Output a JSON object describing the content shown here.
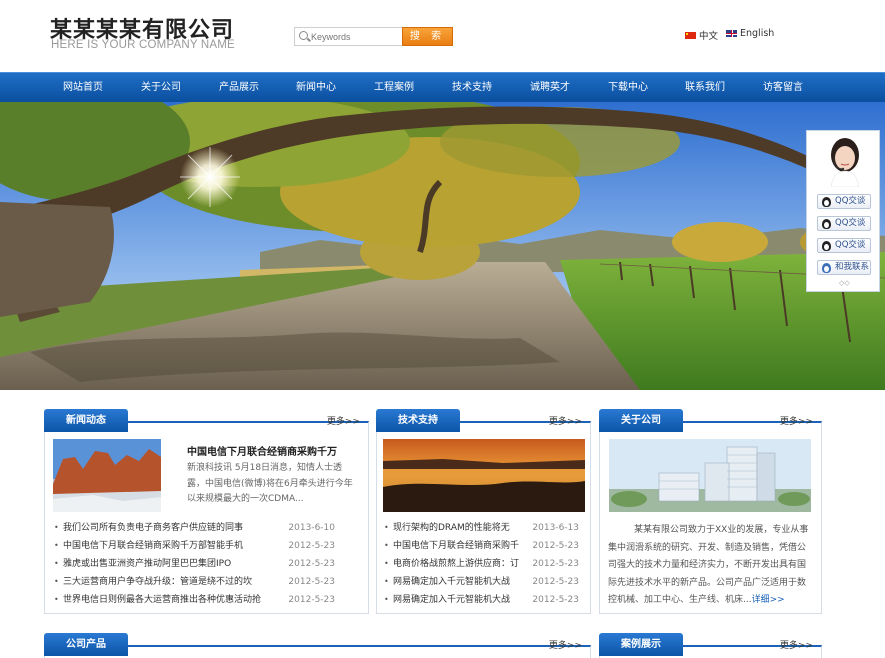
{
  "header": {
    "company_name": "某某某某有限公司",
    "slogan": "HERE IS YOUR COMPANY NAME",
    "search_placeholder": "Keywords",
    "search_button": "搜 索",
    "lang_cn": "中文",
    "lang_en": "English"
  },
  "nav": {
    "items": [
      "网站首页",
      "关于公司",
      "产品展示",
      "新闻中心",
      "工程案例",
      "技术支持",
      "诚聘英才",
      "下载中心",
      "联系我们",
      "访客留言"
    ]
  },
  "service": {
    "buttons": [
      "QQ交谈",
      "QQ交谈",
      "QQ交谈",
      "和我联系"
    ],
    "dots": "◇◇"
  },
  "panels": {
    "more_label": "更多>>",
    "news": {
      "title": "新闻动态",
      "feature_title": "中国电信下月联合经销商采购千万",
      "feature_body": "新浪科技讯 5月18日消息，知情人士透露，中国电信(微博)将在6月牵头进行今年以来规模最大的一次CDMA...",
      "items": [
        {
          "title": "我们公司所有负责电子商务客户供应链的同事",
          "date": "2013-6-10"
        },
        {
          "title": "中国电信下月联合经销商采购千万部智能手机",
          "date": "2012-5-23"
        },
        {
          "title": "雅虎或出售亚洲资产推动阿里巴巴集团IPO",
          "date": "2012-5-23"
        },
        {
          "title": "三大运营商用户争夺战升级：管道是绕不过的坎",
          "date": "2012-5-23"
        },
        {
          "title": "世界电信日则例最各大运营商推出各种优惠活动抢",
          "date": "2012-5-23"
        }
      ]
    },
    "tech": {
      "title": "技术支持",
      "items": [
        {
          "title": "现行架构的DRAM的性能将无",
          "date": "2013-6-13"
        },
        {
          "title": "中国电信下月联合经销商采购千",
          "date": "2012-5-23"
        },
        {
          "title": "电商价格战煎熬上游供应商：订",
          "date": "2012-5-23"
        },
        {
          "title": "网易确定加入千元智能机大战",
          "date": "2012-5-23"
        },
        {
          "title": "网易确定加入千元智能机大战",
          "date": "2012-5-23"
        }
      ]
    },
    "about": {
      "title": "关于公司",
      "text": "某某有限公司致力于XX业的发展，专业从事集中润滑系统的研究、开发、制造及销售，凭借公司强大的技术力量和经济实力，不断开发出具有国际先进技术水平的新产品。公司产品广泛适用于数控机械、加工中心、生产线、机床...",
      "detail": "详细>>"
    },
    "products": {
      "title": "公司产品"
    },
    "cases": {
      "title": "案例展示"
    }
  },
  "colors": {
    "nav_blue": "#0b4f9f",
    "tab_blue": "#1b62b8",
    "search_orange": "#e97d12"
  }
}
